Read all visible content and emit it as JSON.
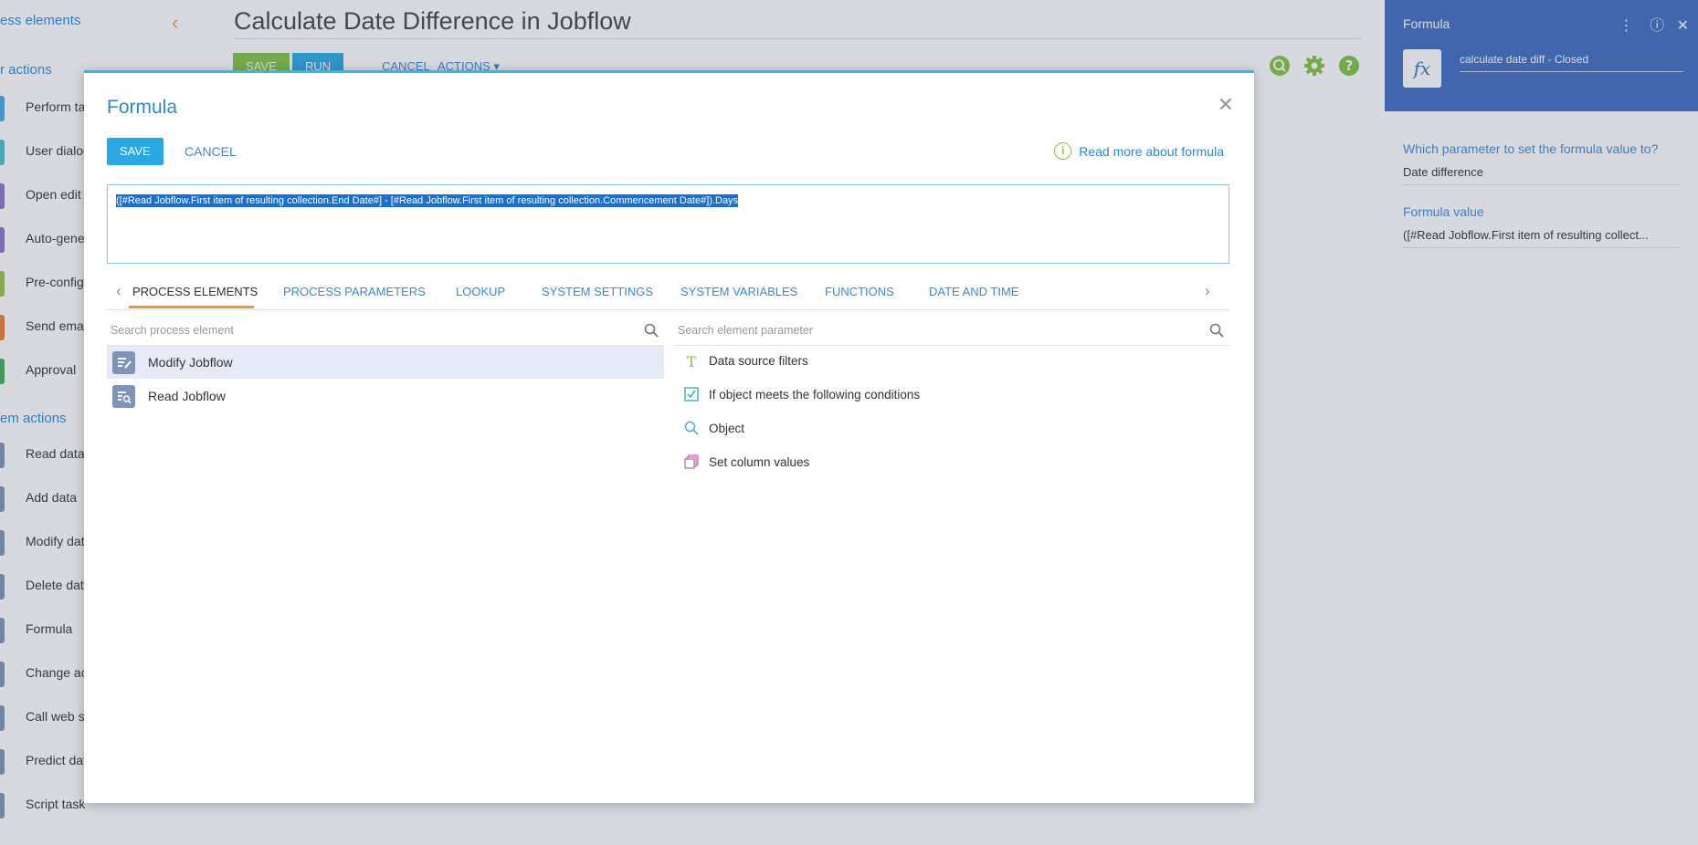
{
  "sidebar": {
    "header": "ess elements",
    "group1": "r actions",
    "group1_items": [
      {
        "label": "Perform ta",
        "color": "#4aa9e6"
      },
      {
        "label": "User dialog",
        "color": "#4ac0c8"
      },
      {
        "label": "Open edit",
        "color": "#8c74c7"
      },
      {
        "label": "Auto-gene",
        "color": "#8c74c7"
      },
      {
        "label": "Pre-config",
        "color": "#9ac14a"
      },
      {
        "label": "Send emai",
        "color": "#f07d3a"
      },
      {
        "label": "Approval",
        "color": "#3fae5a"
      }
    ],
    "group2": "em actions",
    "group2_items": [
      {
        "label": "Read data",
        "color": "#7f94b8"
      },
      {
        "label": "Add data",
        "color": "#7f94b8"
      },
      {
        "label": "Modify dat",
        "color": "#7f94b8"
      },
      {
        "label": "Delete dat",
        "color": "#7f94b8"
      },
      {
        "label": "Formula",
        "color": "#7f94b8"
      },
      {
        "label": "Change ac",
        "color": "#7f94b8"
      },
      {
        "label": "Call web se",
        "color": "#7f94b8"
      },
      {
        "label": "Predict dat",
        "color": "#7f94b8"
      },
      {
        "label": "Script task",
        "color": "#7f94b8"
      }
    ]
  },
  "page": {
    "title": "Calculate Date Difference in Jobflow",
    "toolbar": {
      "save": "SAVE",
      "run": "RUN",
      "cancel": "CANCEL",
      "actions": "ACTIONS"
    }
  },
  "right_panel": {
    "title": "Formula",
    "element_name": "calculate date diff - Closed",
    "fx_label": "fx",
    "param_question": "Which parameter to set the formula value to?",
    "param_value": "Date difference",
    "formula_label": "Formula value",
    "formula_value": "([#Read Jobflow.First item of resulting collect..."
  },
  "modal": {
    "title": "Formula",
    "save": "SAVE",
    "cancel": "CANCEL",
    "read_more": "Read more about formula",
    "formula": "([#Read Jobflow.First item of resulting collection.End Date#] - [#Read Jobflow.First item of resulting collection.Commencement Date#]).Days",
    "tabs": [
      "PROCESS ELEMENTS",
      "PROCESS PARAMETERS",
      "LOOKUP",
      "SYSTEM SETTINGS",
      "SYSTEM VARIABLES",
      "FUNCTIONS",
      "DATE AND TIME"
    ],
    "search_left_placeholder": "Search process element",
    "search_right_placeholder": "Search element parameter",
    "process_elements": [
      "Modify Jobflow",
      "Read Jobflow"
    ],
    "parameters": [
      {
        "label": "Data source filters",
        "icon": "text-icon"
      },
      {
        "label": "If object meets the following conditions",
        "icon": "checkbox-icon"
      },
      {
        "label": "Object",
        "icon": "search-icon"
      },
      {
        "label": "Set column values",
        "icon": "columns-icon"
      }
    ]
  }
}
